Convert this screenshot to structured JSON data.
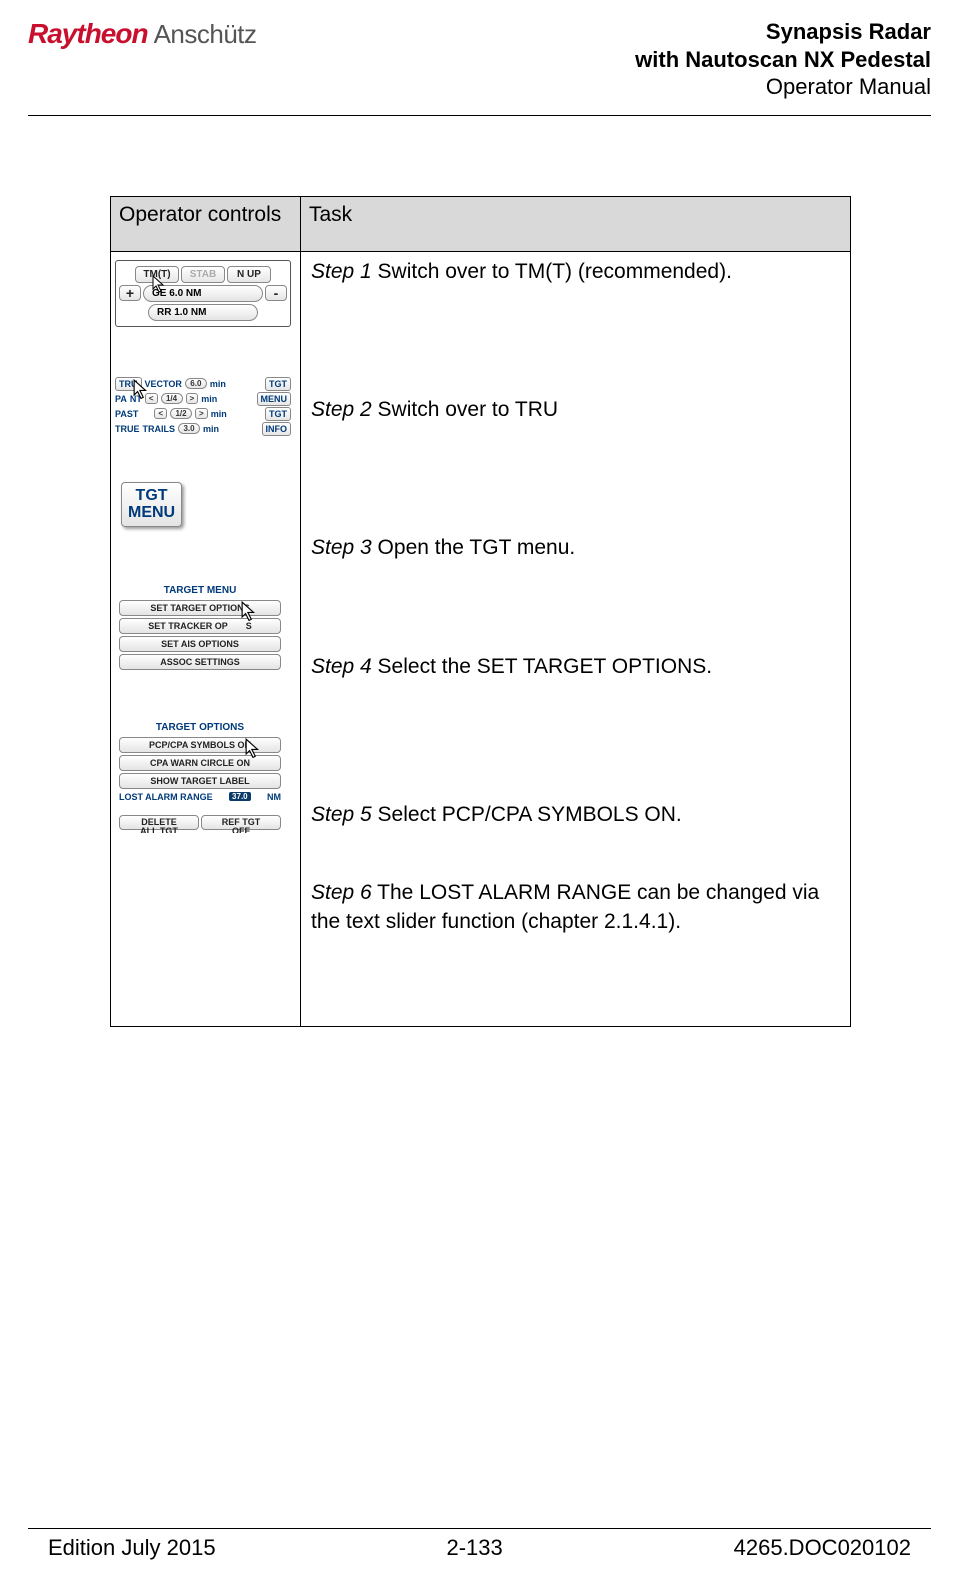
{
  "header": {
    "logo_ray": "Raytheon",
    "logo_ans": "Anschütz",
    "title1": "Synapsis Radar",
    "title2": "with Nautoscan NX Pedestal",
    "title3": "Operator Manual"
  },
  "table": {
    "head_controls": "Operator controls",
    "head_task": "Task",
    "step1": {
      "label": "Step 1",
      "text": " Switch over to TM(T) (recommended)."
    },
    "step2": {
      "label": "Step 2",
      "text": " Switch over to TRU"
    },
    "step3": {
      "label": "Step 3",
      "text": " Open the TGT menu."
    },
    "step4": {
      "label": "Step 4",
      "text": " Select the SET TARGET OPTIONS."
    },
    "step5": {
      "label": "Step 5",
      "text": " Select PCP/CPA SYMBOLS ON."
    },
    "step6": {
      "label": "Step 6",
      "text": " The LOST ALARM RANGE can be changed via the text slider function (chapter 2.1.4.1)."
    }
  },
  "widget1": {
    "tm": "TM(T)",
    "stab": "STAB",
    "nup": "N UP",
    "plus": "+",
    "range": "GE 6.0 NM",
    "minus": "-",
    "rr": "RR 1.0 NM"
  },
  "widget2": {
    "r1a": "TRU",
    "r1b": "VECTOR",
    "r1c": "6.0",
    "r1d": "min",
    "r1e": "TGT",
    "r2a": "PA",
    "r2b": "NT",
    "r2c": "1/4",
    "r2d": "min",
    "r2e": "MENU",
    "r3a": "PAST",
    "r3c": "1/2",
    "r3d": "min",
    "r3e": "TGT",
    "r4a": "TRUE",
    "r4b": "TRAILS",
    "r4c": "3.0",
    "r4d": "min",
    "r4e": "INFO",
    "lt": "<",
    "gt": ">"
  },
  "widget3": {
    "line1": "TGT",
    "line2": "MENU"
  },
  "widget4": {
    "title": "TARGET MENU",
    "b1": "SET TARGET OPTIONS",
    "b2": "SET TRACKER OP",
    "b2tail": "S",
    "b3": "SET AIS OPTIONS",
    "b4": "ASSOC SETTINGS"
  },
  "widget5": {
    "title": "TARGET OPTIONS",
    "b1": "PCP/CPA SYMBOLS ON",
    "b2": "CPA WARN CIRCLE ON",
    "b3": "SHOW TARGET LABEL",
    "lostlabel": "LOST ALARM RANGE",
    "lostval": "37.0",
    "lostunit": "NM",
    "del": "DELETE",
    "del2": "ALL TGT",
    "ref": "REF TGT",
    "ref2": "OFF"
  },
  "footer": {
    "left": "Edition July 2015",
    "center": "2-133",
    "right": "4265.DOC020102"
  }
}
